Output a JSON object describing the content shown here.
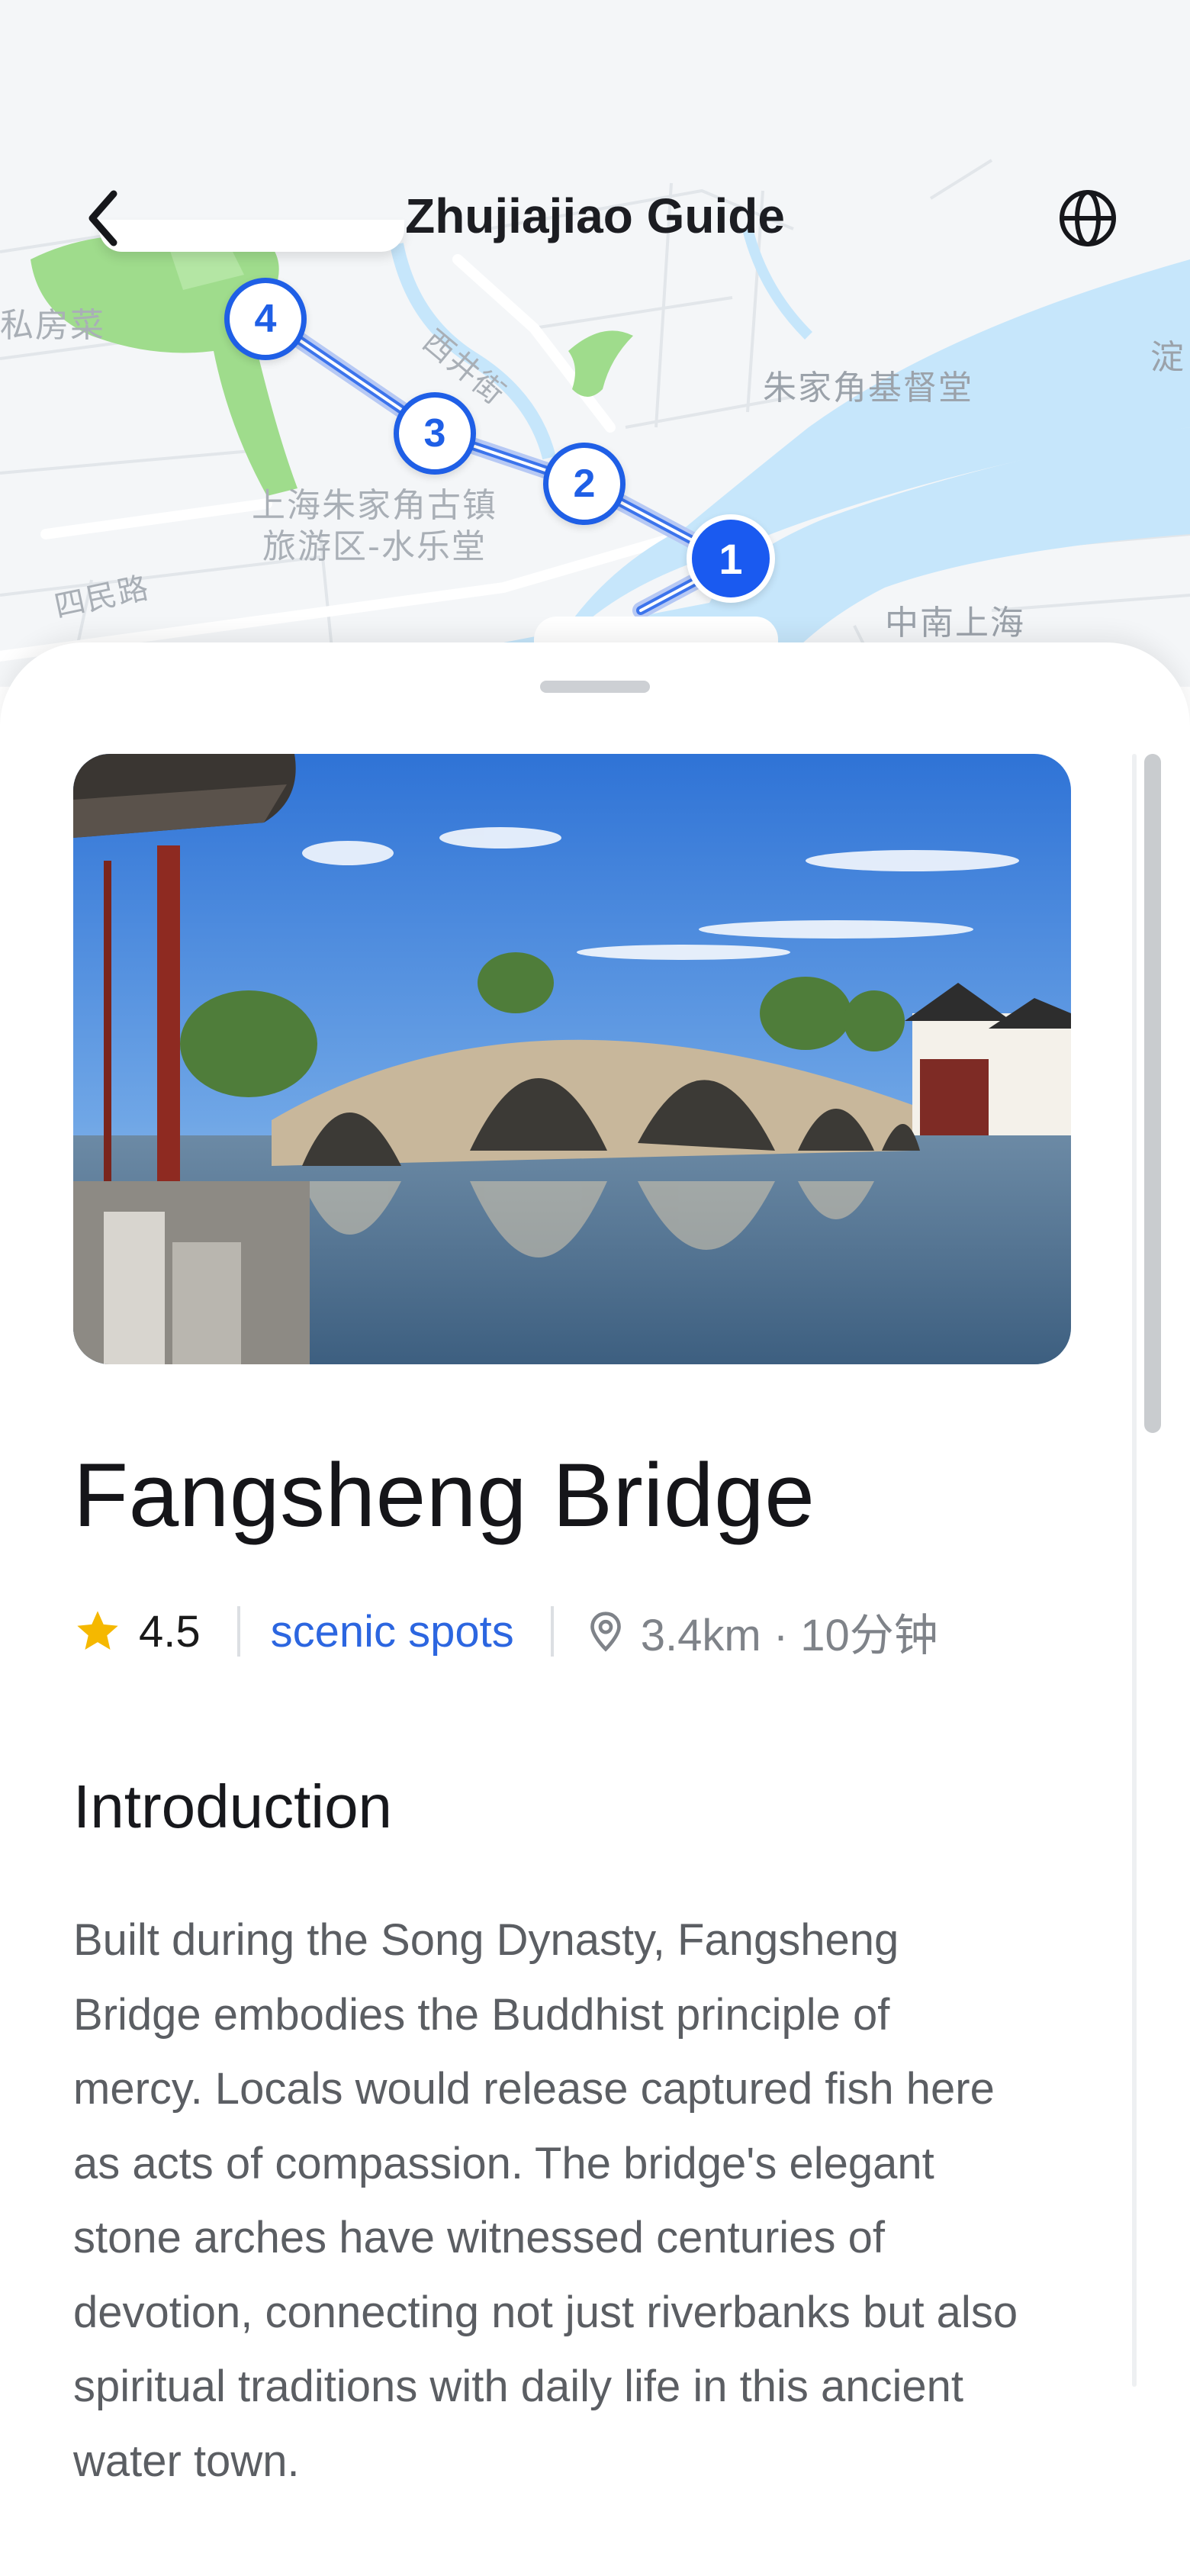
{
  "header": {
    "title": "Zhujiajiao Guide",
    "back_icon": "chevron-left-icon",
    "language_icon": "globe-icon"
  },
  "map": {
    "labels": {
      "restaurant": "私房菜",
      "road_xijing": "西井街",
      "church": "朱家角基督堂",
      "scenic_area_line1": "上海朱家角古镇",
      "scenic_area_line2": "旅游区-水乐堂",
      "road_simin": "四民路",
      "right_edge": "淀",
      "bottom_right": "中南上海"
    },
    "route_stops": [
      "4",
      "3",
      "2",
      "1"
    ],
    "active_stop": "1",
    "colors": {
      "water": "#c6e6fb",
      "park": "#9fdc8c",
      "route": "#1f5fe6"
    }
  },
  "place": {
    "name": "Fangsheng Bridge",
    "rating": "4.5",
    "category": "scenic spots",
    "distance": "3.4km · 10分钟",
    "image_alt": "Fangsheng Bridge photo"
  },
  "introduction": {
    "heading": "Introduction",
    "body": "Built during the Song Dynasty, Fangsheng Bridge embodies the Buddhist principle of mercy. Locals would release captured fish here as acts of compassion. The bridge's elegant stone arches have witnessed centuries of devotion, connecting not just riverbanks but also spiritual traditions with daily life in this ancient water town."
  },
  "colors": {
    "accent": "#2c66e0",
    "star": "#f5b800",
    "text_primary": "#151519",
    "text_secondary": "#5b5e63"
  }
}
